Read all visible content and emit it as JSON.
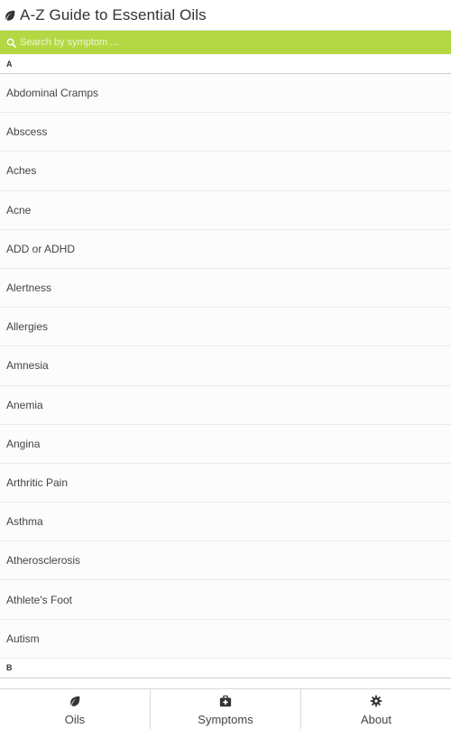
{
  "header": {
    "title": "A-Z Guide to Essential Oils",
    "icon": "leaf-icon"
  },
  "search": {
    "placeholder": "Search by symptom ...",
    "icon": "search-icon",
    "bg_color": "#b3d843"
  },
  "sections": [
    {
      "letter": "A",
      "items": [
        "Abdominal Cramps",
        "Abscess",
        "Aches",
        "Acne",
        "ADD or ADHD",
        "Alertness",
        "Allergies",
        "Amnesia",
        "Anemia",
        "Angina",
        "Arthritic Pain",
        "Asthma",
        "Atherosclerosis",
        "Athlete's Foot",
        "Autism"
      ]
    },
    {
      "letter": "B",
      "items": []
    }
  ],
  "tabs": [
    {
      "label": "Oils",
      "icon": "leaf-icon"
    },
    {
      "label": "Symptoms",
      "icon": "first-aid-kit-icon"
    },
    {
      "label": "About",
      "icon": "gear-icon"
    }
  ]
}
